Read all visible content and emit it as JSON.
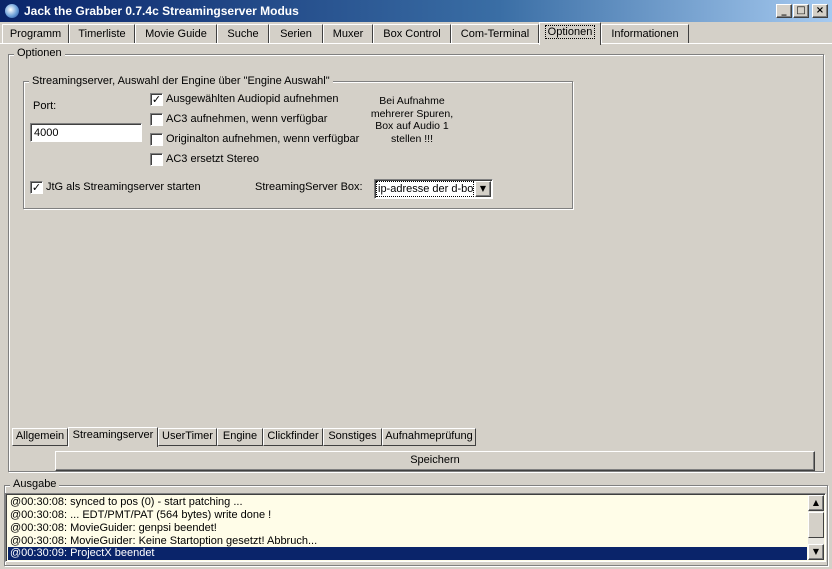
{
  "window": {
    "title": "Jack the Grabber 0.7.4c Streamingserver Modus",
    "minimize": "_",
    "maximize": "□",
    "close": "×"
  },
  "top_tabs": [
    "Programm",
    "Timerliste",
    "Movie Guide",
    "Suche",
    "Serien",
    "Muxer",
    "Box Control",
    "Com-Terminal",
    "Optionen",
    "Informationen"
  ],
  "top_tabs_active": "Optionen",
  "optionen_group": {
    "label": "Optionen"
  },
  "streaming_group": {
    "label": "Streamingserver, Auswahl der Engine über \"Engine Auswahl\"",
    "port_label": "Port:",
    "port_value": "4000",
    "checkboxes": [
      {
        "label": "Ausgewählten Audiopid aufnehmen",
        "checked": true
      },
      {
        "label": "AC3 aufnehmen, wenn verfügbar",
        "checked": false
      },
      {
        "label": "Originalton aufnehmen, wenn verfügbar",
        "checked": false
      },
      {
        "label": "AC3 ersetzt Stereo",
        "checked": false
      }
    ],
    "note": [
      "Bei Aufnahme",
      "mehrerer Spuren,",
      "Box auf Audio 1",
      "stellen !!!"
    ],
    "jtg_checkbox": {
      "label": "JtG  als Streamingserver starten",
      "checked": true
    },
    "box_label": "StreamingServer Box:",
    "box_value": "ip-adresse der d-box"
  },
  "bottom_tabs": [
    "Allgemein",
    "Streamingserver",
    "UserTimer",
    "Engine",
    "Clickfinder",
    "Sonstiges",
    "Aufnahmeprüfung"
  ],
  "bottom_tabs_active": "Streamingserver",
  "save_button": "Speichern",
  "ausgabe": {
    "label": "Ausgabe",
    "lines": [
      "@00:30:08: synced to pos (0) - start patching ...",
      "@00:30:08: ... EDT/PMT/PAT (564 bytes) write done !",
      "@00:30:08: MovieGuider: genpsi beendet!",
      "@00:30:08: MovieGuider: Keine Startoption gesetzt! Abbruch...",
      "@00:30:09: ProjectX beendet"
    ],
    "selected_index": 4
  },
  "colors": {
    "title_start": "#0a246a",
    "title_end": "#a6caf0",
    "face": "#d4d0c8",
    "log_background": "#fffde8",
    "selection": "#0a246a"
  }
}
